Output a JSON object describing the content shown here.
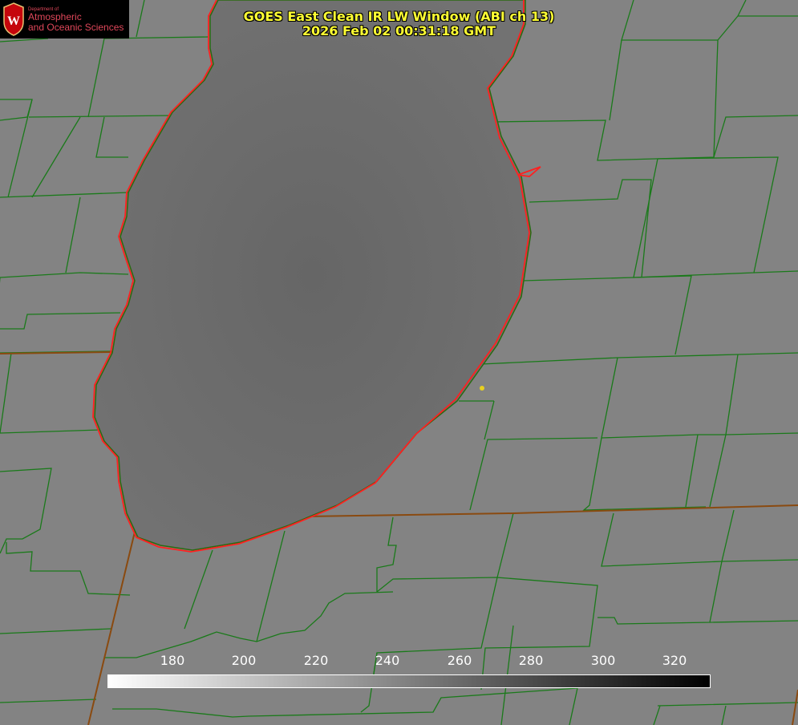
{
  "logo": {
    "small_text": "Department of",
    "line1": "Atmospheric",
    "line2": "and Oceanic Sciences",
    "seal_letter": "W",
    "text_color": "#e0475a"
  },
  "title": {
    "line1": "GOES East Clean IR LW Window (ABI ch 13)",
    "line2": "2026 Feb 02 00:31:18 GMT",
    "color": "#ffff33"
  },
  "colorbar": {
    "min": 162,
    "max": 330,
    "ticks": [
      180,
      200,
      220,
      240,
      260,
      280,
      300,
      320
    ],
    "gradient": [
      "#ffffff",
      "#000000"
    ]
  },
  "colors": {
    "land": "#838383",
    "lake": "#6b6b6b",
    "county_lines": "#1a7a1a",
    "state_lines": "#8a4a10",
    "shoreline": "#ff2020",
    "marker": "#e8d020"
  },
  "icons": {
    "marker": "location-dot-icon",
    "seal": "university-seal-icon"
  }
}
